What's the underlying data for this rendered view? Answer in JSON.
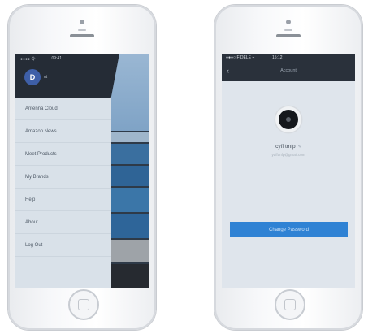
{
  "left_phone": {
    "status_left": "●●●● 令",
    "status_mid": "09:41",
    "user_initial": "D",
    "user_name": "ut",
    "menu": [
      {
        "label": "Antenna Cloud"
      },
      {
        "label": "Amazon News"
      },
      {
        "label": "Meet Products"
      },
      {
        "label": "My Brands"
      },
      {
        "label": "Help"
      },
      {
        "label": "About"
      },
      {
        "label": "Log Out"
      }
    ],
    "colors": {
      "drawer_bg": "#d9e1e9",
      "header_bg": "#252c36",
      "avatar_bg": "#3e5fa8"
    }
  },
  "right_phone": {
    "status_left": "●●●○ FIDELE ⌁",
    "status_mid": "15:12",
    "back_icon": "chevron-left-icon",
    "title": "Account",
    "name": "cyff tmfp",
    "name_edit": "✎",
    "email": "ydfftmfp@gmail.com",
    "change_password_label": "Change Password",
    "colors": {
      "accent": "#2f82d4",
      "nav_bg": "#2a313b"
    }
  }
}
